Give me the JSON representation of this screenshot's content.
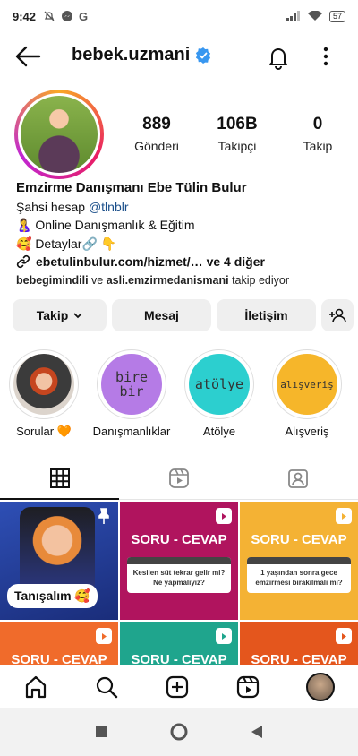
{
  "status": {
    "time": "9:42",
    "battery": "57",
    "icons": [
      "mute-icon",
      "messenger-icon",
      "google-icon"
    ]
  },
  "header": {
    "username": "bebek.uzmani"
  },
  "stats": [
    {
      "num": "889",
      "label": "Gönderi"
    },
    {
      "num": "106B",
      "label": "Takipçi"
    },
    {
      "num": "0",
      "label": "Takip"
    }
  ],
  "bio": {
    "name": "Emzirme Danışmanı Ebe Tülin Bulur",
    "line1_prefix": "Şahsi hesap ",
    "line1_link": "@tlnblr",
    "line2": "🤱 Online Danışmanlık & Eğitim",
    "line3": "🥰 Detaylar🔗 👇",
    "website": "ebetulinbulur.com/hizmet/… ve 4 diğer",
    "followed_user1": "bebegimindili",
    "followed_mid": " ve ",
    "followed_user2": "asli.emzirmedanismani",
    "followed_suffix": " takip ediyor"
  },
  "buttons": {
    "follow": "Takip",
    "message": "Mesaj",
    "contact": "İletişim"
  },
  "highlights": [
    {
      "label": "Sorular 🧡",
      "inner": "",
      "color": "#e9d7cf"
    },
    {
      "label": "Danışmanlıklar",
      "inner": "bire bir",
      "color": "#b57be6"
    },
    {
      "label": "Atölye",
      "inner": "atölye",
      "color": "#2ccfcf"
    },
    {
      "label": "Alışveriş",
      "inner": "alışveriş",
      "color": "#f6b62a"
    }
  ],
  "posts": [
    {
      "title": "",
      "text": "Tanışalım 🥰"
    },
    {
      "title": "SORU - CEVAP",
      "text": "Kesilen süt tekrar gelir mi? Ne yapmalıyız?"
    },
    {
      "title": "SORU - CEVAP",
      "text": "1 yaşından sonra gece emzirmesi bırakılmalı mı?"
    },
    {
      "title": "SORU - CEVAP",
      "text": ""
    },
    {
      "title": "SORU - CEVAP",
      "text": ""
    },
    {
      "title": "SORU - CEVAP",
      "text": ""
    }
  ],
  "colors": {
    "accent": "#3897f0",
    "link": "#1b4f8a",
    "button_bg": "#efefef"
  }
}
